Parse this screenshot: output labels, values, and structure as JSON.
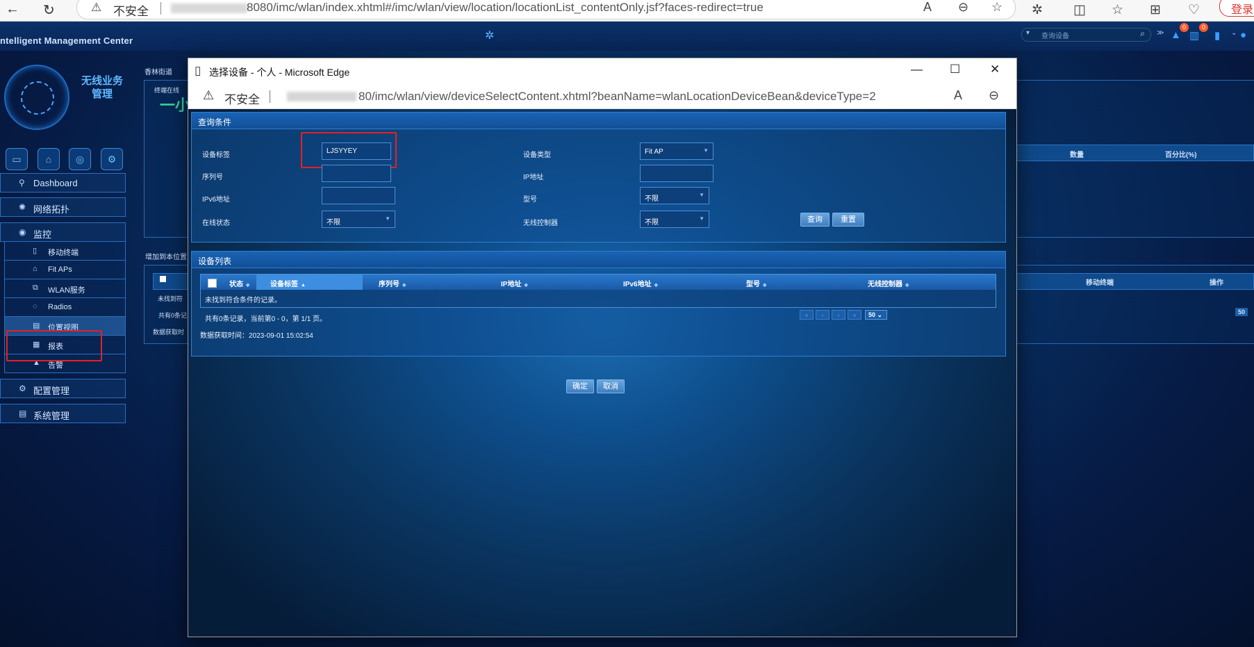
{
  "browser": {
    "insecure_label": "不安全",
    "url": "8080/imc/wlan/index.xhtml#/imc/wlan/view/location/locationList_contentOnly.jsf?faces-redirect=true",
    "login_label": "登录"
  },
  "app": {
    "brand": "ntelligent Management Center",
    "search_placeholder": "查询设备",
    "alarm_badge": "0",
    "report_badge": "0"
  },
  "sidebar": {
    "module_title": "无线业务管理",
    "menu": {
      "dashboard": "Dashboard",
      "topology": "网络拓扑",
      "monitor": "监控",
      "config": "配置管理",
      "system": "系统管理"
    },
    "submenu": {
      "mobile": "移动终端",
      "fitaps": "Fit APs",
      "wlan": "WLAN服务",
      "radios": "Radios",
      "location": "位置视图",
      "report": "报表",
      "alarm": "告警"
    }
  },
  "background_page": {
    "breadcrumb": "香林街道",
    "terminal_label": "终端在线",
    "big_text": "一小",
    "add_label": "增加到本位置",
    "col_count": "数量",
    "col_percent": "百分比(%)",
    "col_mobile": "移动终端",
    "col_ops": "操作",
    "not_found": "未找到符",
    "total": "共有0条记",
    "fetch": "数据获取时",
    "page_size": "50"
  },
  "popup": {
    "title": "选择设备 - 个人 - Microsoft Edge",
    "insecure_label": "不安全",
    "url": "80/imc/wlan/view/deviceSelectContent.xhtml?beanName=wlanLocationDeviceBean&deviceType=2",
    "query": {
      "heading": "查询条件",
      "device_label_lbl": "设备标签",
      "device_label_val": "LJSYYEY",
      "serial_lbl": "序列号",
      "serial_val": "",
      "ipv6_lbl": "IPv6地址",
      "ipv6_val": "",
      "online_lbl": "在线状态",
      "online_val": "不限",
      "type_lbl": "设备类型",
      "type_val": "Fit AP",
      "ip_lbl": "IP地址",
      "ip_val": "",
      "model_lbl": "型号",
      "model_val": "不限",
      "controller_lbl": "无线控制器",
      "controller_val": "不限",
      "search_btn": "查询",
      "reset_btn": "重置"
    },
    "list": {
      "heading": "设备列表",
      "columns": [
        "状态",
        "设备标签",
        "序列号",
        "IP地址",
        "IPv6地址",
        "型号",
        "无线控制器"
      ],
      "empty_text": "未找到符合条件的记录。",
      "pager_text": "共有0条记录，当前第0 - 0，第 1/1 页。",
      "page_size": "50",
      "fetch_time": "数据获取时间：2023-09-01 15:02:54"
    },
    "ok_btn": "确定",
    "cancel_btn": "取消"
  }
}
